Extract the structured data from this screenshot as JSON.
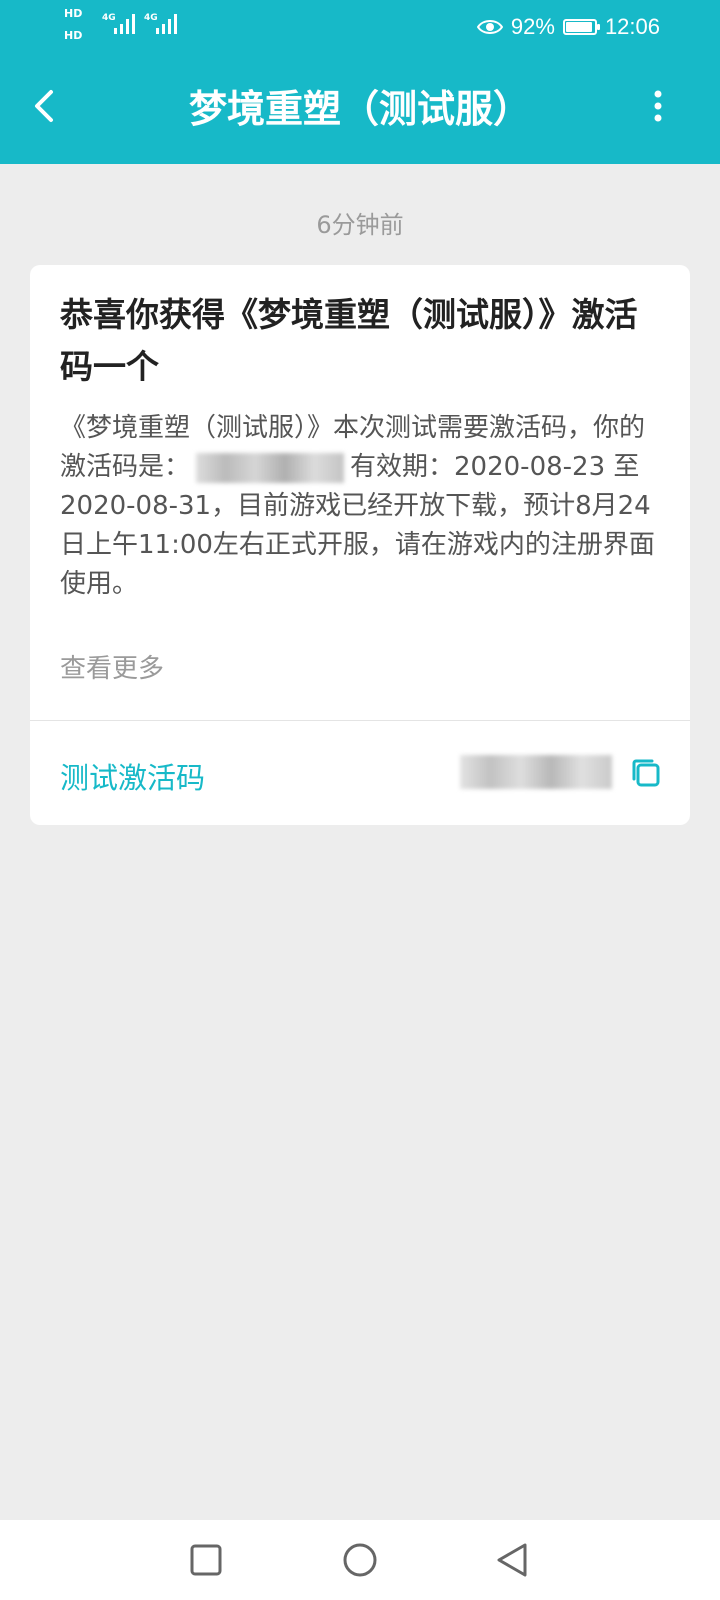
{
  "status_bar": {
    "hd_1": "HD",
    "hd_2": "HD",
    "net_1": "4G",
    "net_2": "4G",
    "battery_pct": "92%",
    "battery_level": 0.92,
    "time": "12:06"
  },
  "header": {
    "title": "梦境重塑（测试服）"
  },
  "message": {
    "timestamp": "6分钟前",
    "title": "恭喜你获得《梦境重塑（测试服）》激活码一个",
    "body_before_code": "《梦境重塑（测试服）》本次测试需要激活码，你的激活码是：",
    "body_after_code": "有效期：2020-08-23 至 2020-08-31，目前游戏已经开放下载，预计8月24日上午11:00左右正式开服，请在游戏内的注册界面使用。",
    "view_more": "查看更多",
    "code_label": "测试激活码"
  },
  "colors": {
    "accent": "#17b9c8",
    "background": "#ededed"
  },
  "icons": {
    "back": "chevron-left-icon",
    "more": "more-vertical-icon",
    "copy": "copy-icon",
    "nav_recent": "square-icon",
    "nav_home": "circle-icon",
    "nav_back": "triangle-left-icon",
    "eye": "eye-icon"
  }
}
